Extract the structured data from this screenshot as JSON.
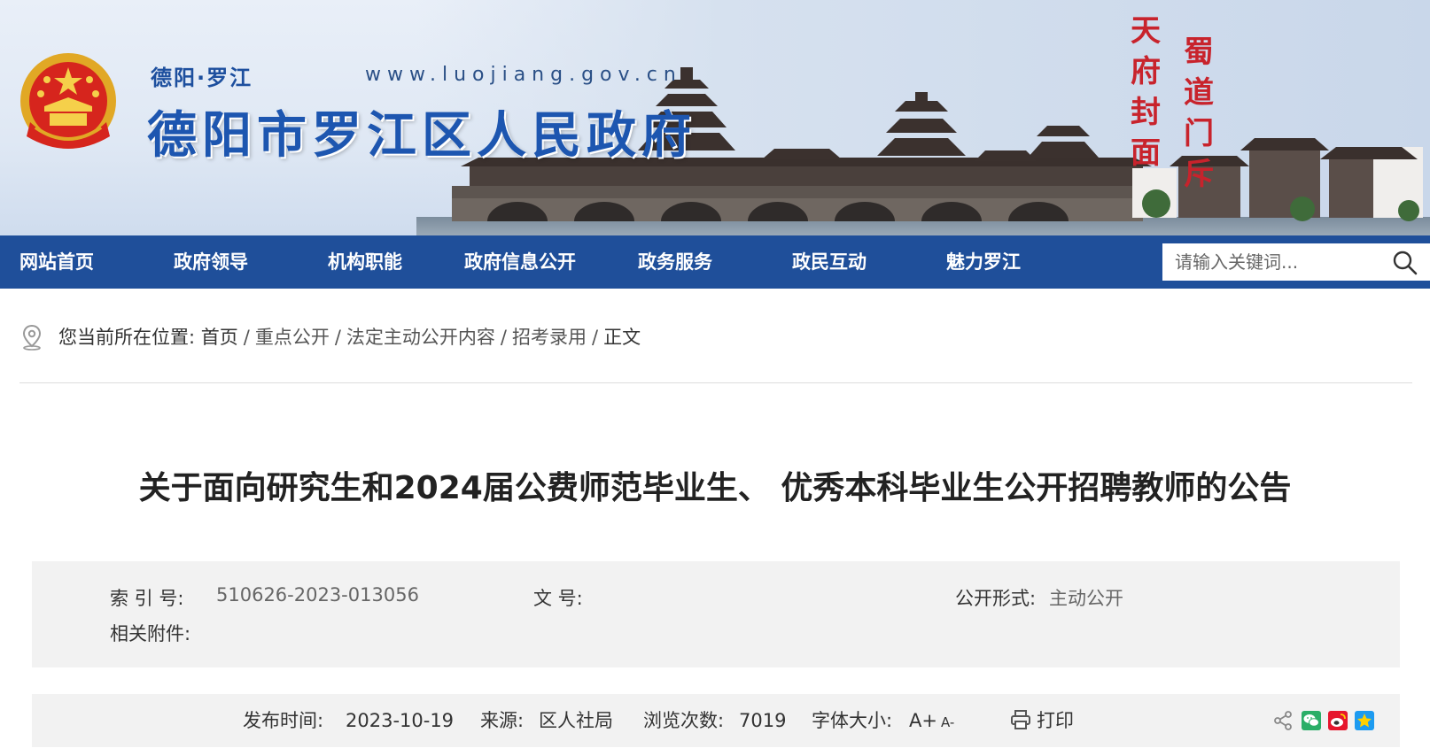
{
  "header": {
    "subtitle": "德阳·罗江",
    "url": "www.luojiang.gov.cn",
    "title": "德阳市罗江区人民政府",
    "calligraphy_left": [
      "天",
      "府",
      "封",
      "面"
    ],
    "calligraphy_right": [
      "蜀",
      "道",
      "门",
      "斥"
    ]
  },
  "nav": {
    "items": [
      "网站首页",
      "政府领导",
      "机构职能",
      "政府信息公开",
      "政务服务",
      "政民互动",
      "魅力罗江"
    ],
    "search_placeholder": "请输入关键词..."
  },
  "breadcrumb": {
    "prefix": "您当前所在位置:",
    "items": [
      "首页",
      "重点公开",
      "法定主动公开内容",
      "招考录用",
      "正文"
    ],
    "separator": "/"
  },
  "article": {
    "title": "关于面向研究生和2024届公费师范毕业生、 优秀本科毕业生公开招聘教师的公告"
  },
  "meta": {
    "index_label": "索  引  号:",
    "index_value": "510626-2023-013056",
    "doc_no_label": "文    号:",
    "doc_no_value": "",
    "disclosure_label": "公开形式:",
    "disclosure_value": "主动公开",
    "attachments_label": "相关附件:",
    "attachments_value": ""
  },
  "info": {
    "publish_label": "发布时间:",
    "publish_value": "2023-10-19",
    "source_label": "来源:",
    "source_value": "区人社局",
    "views_label": "浏览次数:",
    "views_value": "7019",
    "font_label": "字体大小:",
    "font_larger": "A+",
    "font_smaller": "A-",
    "print_label": "打印"
  },
  "icons": {
    "location": "location-pin-icon",
    "search": "search-icon",
    "print": "printer-icon",
    "share": "share-icon",
    "wechat": "wechat-icon",
    "weibo": "weibo-icon",
    "qzone": "qzone-icon"
  },
  "colors": {
    "nav_bg": "#1f4f9a",
    "title_blue": "#1d56b0",
    "meta_bg": "#f2f2f2",
    "calligraphy_red": "#c8232c"
  }
}
